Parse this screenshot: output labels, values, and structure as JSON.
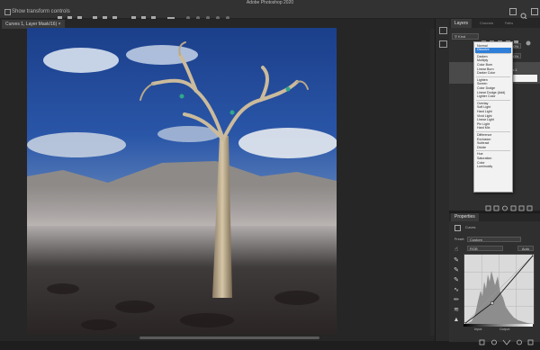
{
  "app": {
    "window_title": "Adobe Photoshop 2020",
    "document_tab": "Curves 1, Layer Mask/16) ×"
  },
  "options_bar": {
    "checkbox_label": "Show transform controls"
  },
  "layers_panel": {
    "tabs": [
      "Layers",
      "Channels",
      "Paths"
    ],
    "kind_label": "Kind",
    "blend_mode_value": "Normal",
    "opacity_label": "Opacity:",
    "opacity_value": "100%",
    "fill_label": "Fill:",
    "fill_value": "100%",
    "layers": [
      {
        "name": "Curves 1"
      },
      {
        "name": ""
      },
      {
        "name": "Layer 3"
      },
      {
        "name": "Background"
      }
    ]
  },
  "blend_menu": {
    "groups": [
      [
        "Normal",
        "Dissolve"
      ],
      [
        "Darken",
        "Multiply",
        "Color Burn",
        "Linear Burn",
        "Darker Color"
      ],
      [
        "Lighten",
        "Screen",
        "Color Dodge",
        "Linear Dodge (Add)",
        "Lighter Color"
      ],
      [
        "Overlay",
        "Soft Light",
        "Hard Light",
        "Vivid Light",
        "Linear Light",
        "Pin Light",
        "Hard Mix"
      ],
      [
        "Difference",
        "Exclusion",
        "Subtract",
        "Divide"
      ],
      [
        "Hue",
        "Saturation",
        "Color",
        "Luminosity"
      ]
    ],
    "highlighted": "Dissolve"
  },
  "properties_panel": {
    "title": "Properties",
    "adjustment_label": "Curves",
    "preset_label": "Preset:",
    "preset_value": "Custom",
    "channel_value": "RGB",
    "auto_button": "Auto",
    "input_label": "Input:",
    "output_label": "Output:"
  },
  "curve": {
    "points": [
      [
        0,
        0
      ],
      [
        40,
        30
      ],
      [
        100,
        100
      ]
    ]
  },
  "colors": {
    "highlight": "#2f7fd8",
    "panel_bg": "#2f2f2f",
    "app_bg": "#1e1e1e"
  }
}
